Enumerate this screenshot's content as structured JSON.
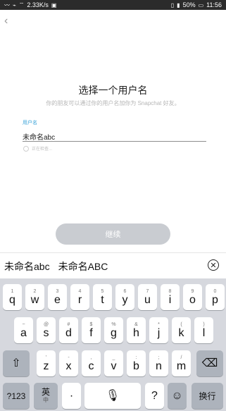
{
  "status_bar": {
    "speed": "2.33K/s",
    "battery": "50%",
    "time": "11:56"
  },
  "app": {
    "back_icon": "chevron-left-icon",
    "title": "选择一个用户名",
    "subtitle": "你的朋友可以通过你的用户名加你为 Snapchat 好友。",
    "field_label": "用户名",
    "username_value": "未命名abc",
    "checking_text": "正在检查...",
    "continue_label": "继续"
  },
  "candidates": {
    "items": [
      "未命名abc",
      "未命名ABC"
    ],
    "close_icon": "close-circle-icon"
  },
  "keyboard": {
    "row1": [
      {
        "key": "q",
        "hint": "1"
      },
      {
        "key": "w",
        "hint": "2"
      },
      {
        "key": "e",
        "hint": "3"
      },
      {
        "key": "r",
        "hint": "4"
      },
      {
        "key": "t",
        "hint": "5"
      },
      {
        "key": "y",
        "hint": "6"
      },
      {
        "key": "u",
        "hint": "7"
      },
      {
        "key": "i",
        "hint": "8"
      },
      {
        "key": "o",
        "hint": "9"
      },
      {
        "key": "p",
        "hint": "0"
      }
    ],
    "row2": [
      {
        "key": "a",
        "hint": "~"
      },
      {
        "key": "s",
        "hint": "@"
      },
      {
        "key": "d",
        "hint": "#"
      },
      {
        "key": "f",
        "hint": "$"
      },
      {
        "key": "g",
        "hint": "%"
      },
      {
        "key": "h",
        "hint": "&"
      },
      {
        "key": "j",
        "hint": "*"
      },
      {
        "key": "k",
        "hint": "("
      },
      {
        "key": "l",
        "hint": ")"
      }
    ],
    "row3": [
      {
        "key": "z",
        "hint": "'"
      },
      {
        "key": "x",
        "hint": "-"
      },
      {
        "key": "c",
        "hint": ","
      },
      {
        "key": "v",
        "hint": "_"
      },
      {
        "key": "b",
        "hint": ":"
      },
      {
        "key": "n",
        "hint": ";"
      },
      {
        "key": "m",
        "hint": "/"
      }
    ],
    "shift_icon": "shift-icon",
    "backspace_icon": "backspace-icon",
    "numeric_label": "?123",
    "lang_label": "英",
    "lang_sub": "中",
    "dot_label": "·",
    "space_icon": "microphone-icon",
    "question_label": "?",
    "emoji_icon": "emoji-icon",
    "enter_label": "换行"
  }
}
